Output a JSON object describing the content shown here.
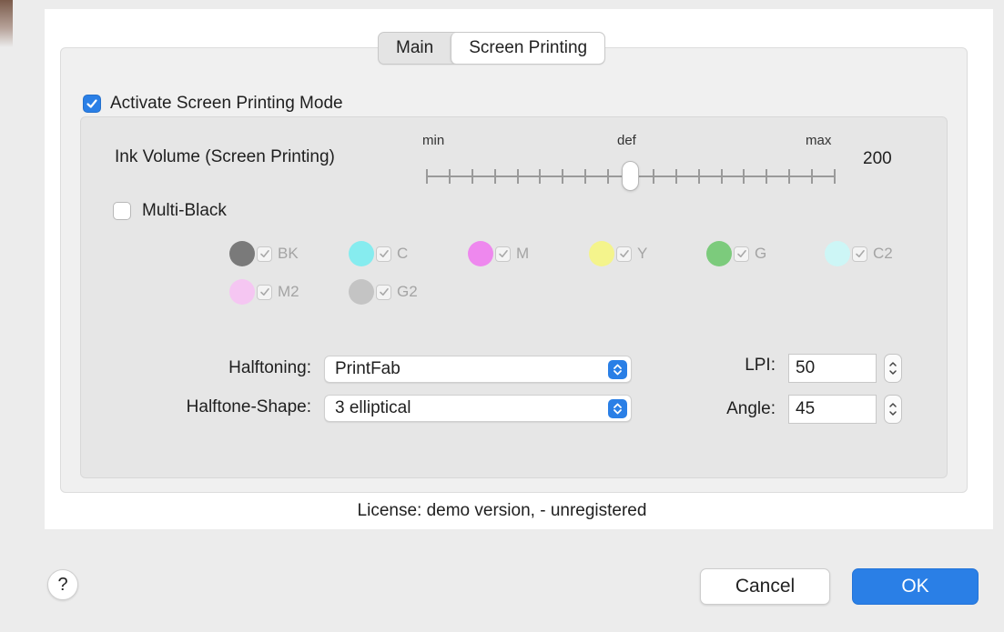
{
  "tabs": [
    {
      "label": "Main",
      "selected": false
    },
    {
      "label": "Screen Printing",
      "selected": true
    }
  ],
  "activate": {
    "label": "Activate Screen Printing Mode",
    "checked": true
  },
  "ink_volume": {
    "label": "Ink Volume (Screen Printing)",
    "min_label": "min",
    "def_label": "def",
    "max_label": "max",
    "value": "200",
    "ticks": 19,
    "knob_position_fraction": 0.5
  },
  "multi_black": {
    "label": "Multi-Black",
    "checked": false
  },
  "inks": [
    {
      "name": "BK",
      "color": "#7a7a7a"
    },
    {
      "name": "C",
      "color": "#86ecef"
    },
    {
      "name": "M",
      "color": "#ee88ee"
    },
    {
      "name": "Y",
      "color": "#f4f48c"
    },
    {
      "name": "G",
      "color": "#7ccb7c"
    },
    {
      "name": "C2",
      "color": "#cdf6f6"
    },
    {
      "name": "M2",
      "color": "#f5c6f2"
    },
    {
      "name": "G2",
      "color": "#c4c4c4"
    }
  ],
  "halftoning": {
    "label": "Halftoning:",
    "value": "PrintFab"
  },
  "halftone_shape": {
    "label": "Halftone-Shape:",
    "value": "3 elliptical"
  },
  "lpi": {
    "label": "LPI:",
    "value": "50"
  },
  "angle": {
    "label": "Angle:",
    "value": "45"
  },
  "license": "License: demo version,  - unregistered",
  "help_label": "?",
  "buttons": {
    "cancel": "Cancel",
    "ok": "OK"
  },
  "colors": {
    "accent": "#2a7fe6"
  }
}
